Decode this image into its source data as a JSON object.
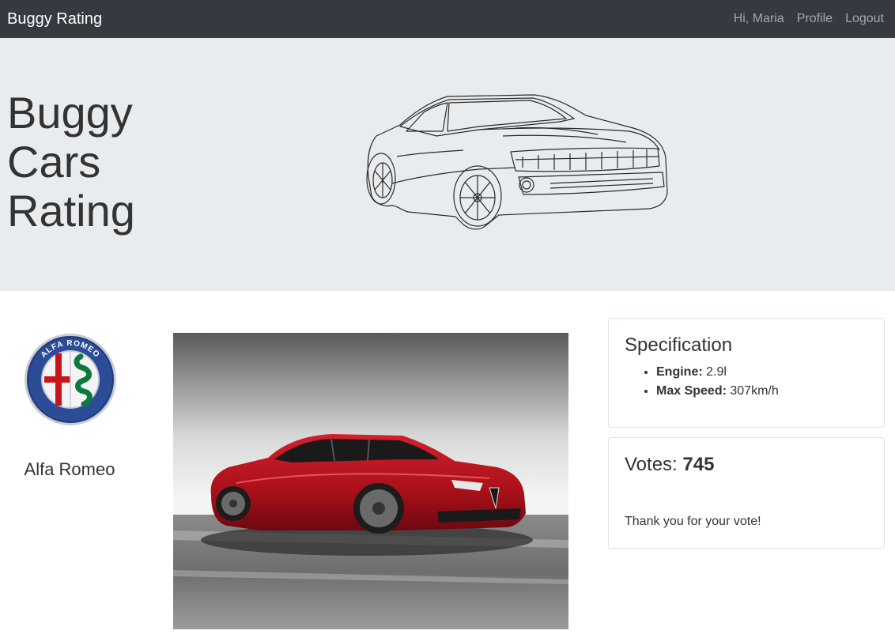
{
  "navbar": {
    "brand": "Buggy Rating",
    "greeting": "Hi, Maria",
    "profile": "Profile",
    "logout": "Logout"
  },
  "hero": {
    "title": "Buggy Cars Rating"
  },
  "make": {
    "name": "Alfa Romeo",
    "logo_text": "ALFA ROMEO"
  },
  "spec": {
    "title": "Specification",
    "engine_label": "Engine:",
    "engine_value": "2.9l",
    "speed_label": "Max Speed:",
    "speed_value": "307km/h"
  },
  "votes": {
    "label": "Votes:",
    "count": "745",
    "message": "Thank you for your vote!"
  },
  "colors": {
    "navbar_bg": "#343a40",
    "jumbotron_bg": "#e9ecef",
    "car_red": "#b3121f"
  }
}
